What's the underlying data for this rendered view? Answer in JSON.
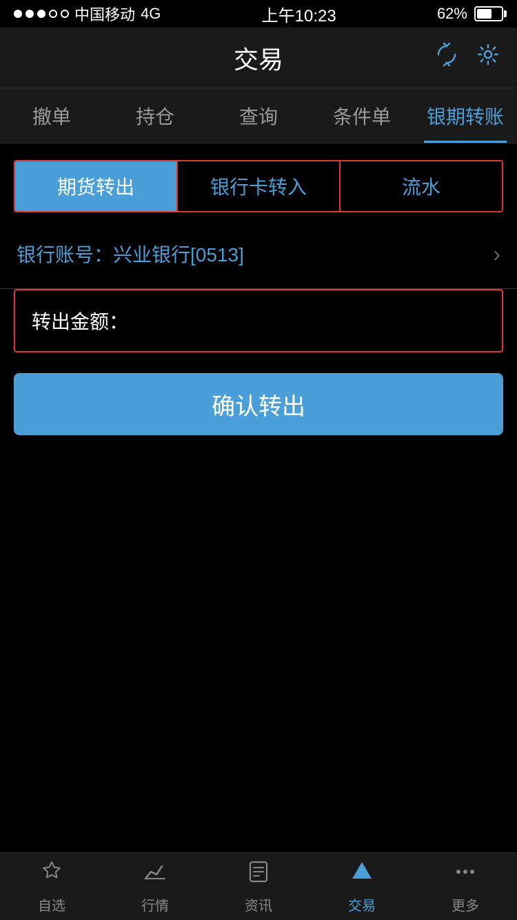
{
  "statusBar": {
    "carrier": "中国移动",
    "network": "4G",
    "time": "上午10:23",
    "battery": "62%"
  },
  "header": {
    "title": "交易",
    "refreshIconLabel": "刷新",
    "settingsIconLabel": "设置"
  },
  "navTabs": [
    {
      "label": "撤单",
      "active": false
    },
    {
      "label": "持仓",
      "active": false
    },
    {
      "label": "查询",
      "active": false
    },
    {
      "label": "条件单",
      "active": false
    },
    {
      "label": "银期转账",
      "active": true
    }
  ],
  "subTabs": [
    {
      "label": "期货转出",
      "active": true
    },
    {
      "label": "银行卡转入",
      "active": false
    },
    {
      "label": "流水",
      "active": false
    }
  ],
  "bankAccount": {
    "prefix": "银行账号：兴业银行",
    "suffix": "[0513]"
  },
  "amountField": {
    "label": "转出金额：",
    "placeholder": "",
    "value": ""
  },
  "confirmButton": {
    "label": "确认转出"
  },
  "bottomTabs": [
    {
      "label": "自选",
      "active": false,
      "icon": "star"
    },
    {
      "label": "行情",
      "active": false,
      "icon": "chart"
    },
    {
      "label": "资讯",
      "active": false,
      "icon": "news"
    },
    {
      "label": "交易",
      "active": true,
      "icon": "trade"
    },
    {
      "label": "更多",
      "active": false,
      "icon": "more"
    }
  ]
}
